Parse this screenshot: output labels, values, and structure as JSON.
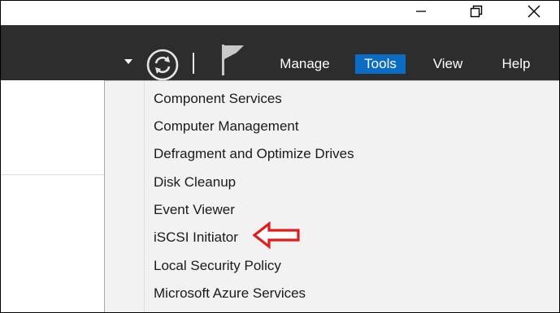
{
  "window_controls": {
    "minimize_icon": "minimize-icon",
    "maximize_icon": "restore-icon",
    "close_icon": "close-icon"
  },
  "toolbar": {
    "background": "#2d2d2d",
    "menu": {
      "manage": "Manage",
      "tools": "Tools",
      "view": "View",
      "help": "Help"
    },
    "tools_highlight": "#0a6cc4"
  },
  "tools_menu": {
    "items": [
      "Component Services",
      "Computer Management",
      "Defragment and Optimize Drives",
      "Disk Cleanup",
      "Event Viewer",
      "iSCSI Initiator",
      "Local Security Policy",
      "Microsoft Azure Services"
    ],
    "annotation": {
      "icon": "red-arrow-icon",
      "color": "#e21b1b",
      "points_to": "iSCSI Initiator"
    }
  }
}
